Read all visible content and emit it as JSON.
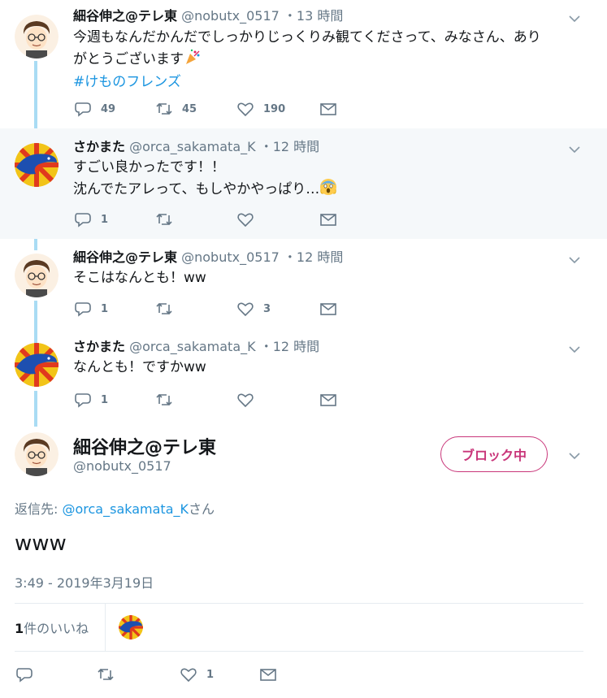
{
  "thread": [
    {
      "name": "細谷伸之@テレ東",
      "handle": "@nobutx_0517",
      "dot": "・",
      "time": "13 時間",
      "lines": [
        "今週もなんだかんだでしっかりじっくりみ観てくださって、みなさん、あり",
        "がとうございます"
      ],
      "hashtag": "#けものフレンズ",
      "replies": "49",
      "retweets": "45",
      "likes": "190"
    },
    {
      "name": "さかまた",
      "handle": "@orca_sakamata_K",
      "dot": "・",
      "time": "12 時間",
      "lines": [
        "すごい良かったです！！",
        "沈んでたアレって、もしやかやっぱり…"
      ],
      "replies": "1",
      "retweets": "",
      "likes": ""
    },
    {
      "name": "細谷伸之@テレ東",
      "handle": "@nobutx_0517",
      "dot": "・",
      "time": "12 時間",
      "lines": [
        "そこはなんとも！ww"
      ],
      "replies": "1",
      "retweets": "",
      "likes": "3"
    },
    {
      "name": "さかまた",
      "handle": "@orca_sakamata_K",
      "dot": "・",
      "time": "12 時間",
      "lines": [
        "なんとも！ですかww"
      ],
      "replies": "1",
      "retweets": "",
      "likes": ""
    }
  ],
  "main_tweet": {
    "name": "細谷伸之@テレ東",
    "handle": "@nobutx_0517",
    "block_button": "ブロック中",
    "reply_prefix": "返信先: ",
    "reply_mention": "@orca_sakamata_K",
    "reply_suffix": "さん",
    "text": "www",
    "timestamp": "3:49 - 2019年3月19日",
    "likes_count": "1",
    "likes_label": "件のいいね",
    "replies": "",
    "retweets": "",
    "likes": "1"
  },
  "colors": {
    "accent": "#1b95e0",
    "thread_line": "#a9dcf4",
    "block": "#c9367a",
    "muted": "#657786",
    "highlight_bg": "#f5f8fa"
  },
  "icons": [
    "reply-icon",
    "retweet-icon",
    "like-icon",
    "dm-icon",
    "chevron-down-icon",
    "party-popper-emoji",
    "scream-emoji"
  ]
}
